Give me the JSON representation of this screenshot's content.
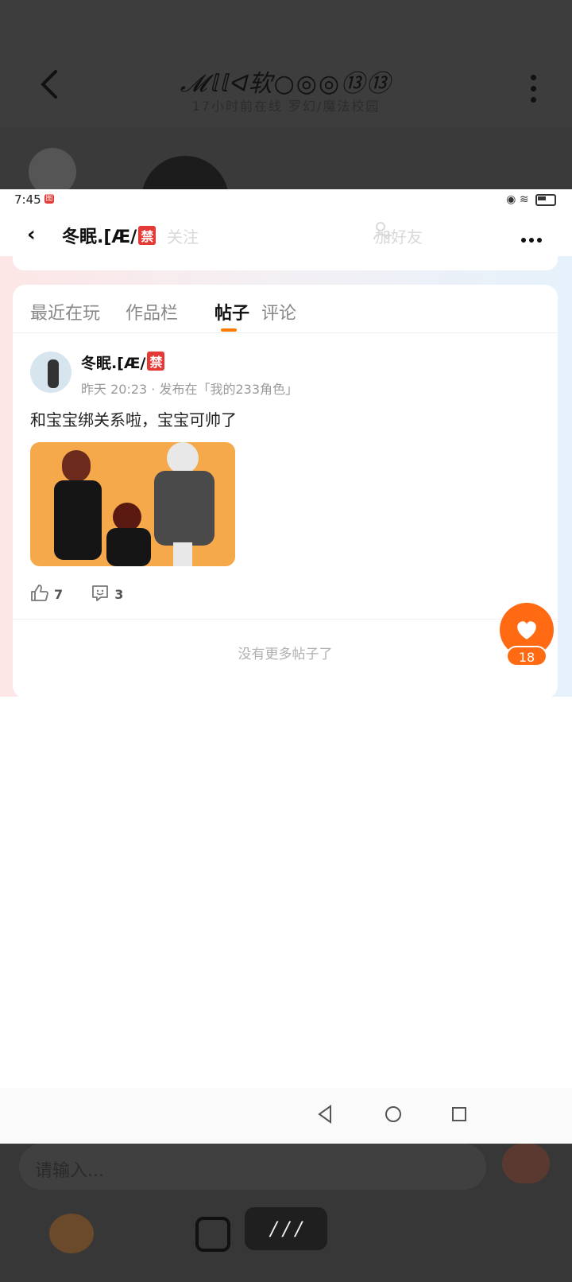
{
  "background_page": {
    "title": "𝓜𝕝𝕝ᐊ软○◎◎⑬⑬",
    "subtitle": "17小时前在线 罗幻/魔法校园",
    "input_placeholder": "请输入...",
    "voice_label": "/ / /"
  },
  "status_bar": {
    "time": "7:45",
    "badge": "图"
  },
  "top_nav": {
    "name": "冬眠.[Æ/",
    "ban_badge": "禁",
    "follow_label": "关注",
    "add_friend_label": "加好友"
  },
  "tabs": [
    {
      "label": "最近在玩",
      "active": false
    },
    {
      "label": "作品栏",
      "active": false
    },
    {
      "label": "帖子",
      "active": true
    },
    {
      "label": "评论",
      "active": false
    }
  ],
  "post": {
    "author": "冬眠.[Æ/",
    "author_badge": "禁",
    "time": "昨天 20:23",
    "separator": "·",
    "posted_in": "发布在「我的233角色」",
    "body": "和宝宝绑关系啦，宝宝可帅了",
    "likes": "7",
    "comments": "3"
  },
  "no_more_text": "没有更多帖子了",
  "fab": {
    "count": "18"
  },
  "colors": {
    "accent": "#ff6a13",
    "ban_red": "#e53935",
    "image_bg": "#f6a94a"
  }
}
